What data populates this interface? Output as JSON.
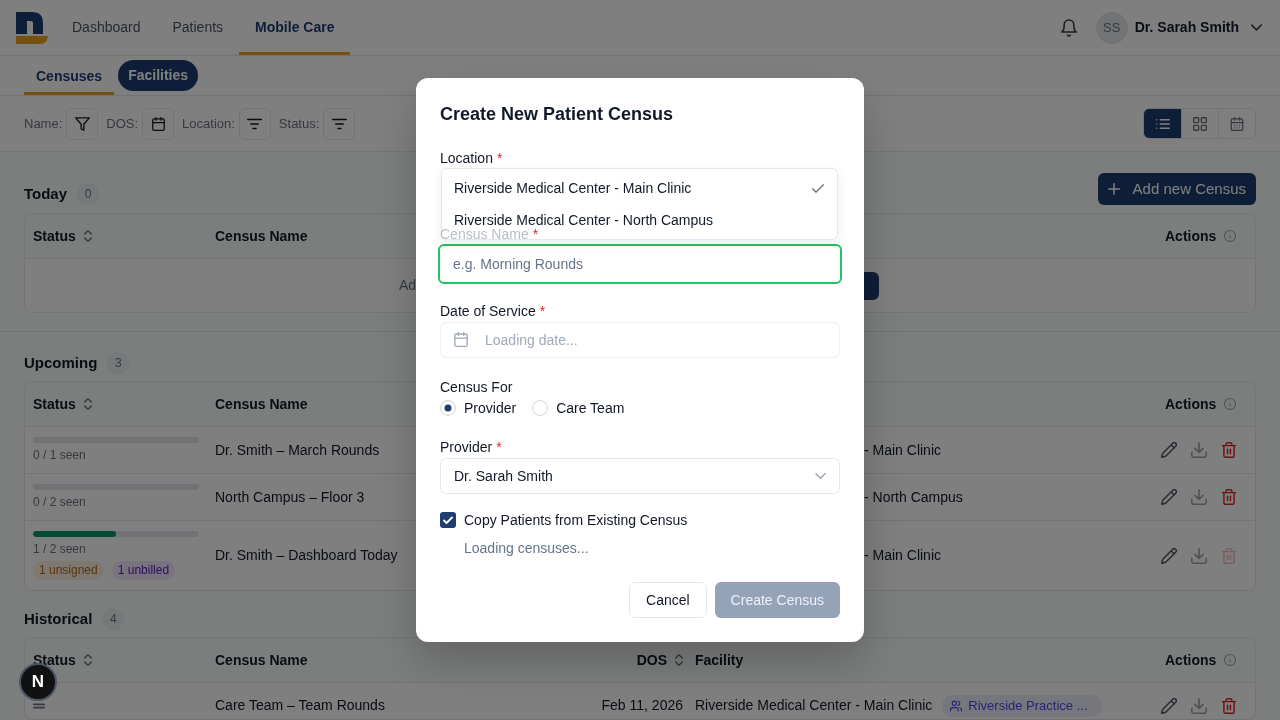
{
  "app_bar": {
    "nav": [
      {
        "label": "Dashboard",
        "selected": false
      },
      {
        "label": "Patients",
        "selected": false
      },
      {
        "label": "Mobile Care",
        "selected": true
      }
    ],
    "avatar": "SS",
    "user_name": "Dr. Sarah Smith"
  },
  "subtabs": [
    {
      "label": "Censuses",
      "selected": true,
      "highlighted": false
    },
    {
      "label": "Facilities",
      "selected": false,
      "highlighted": true
    }
  ],
  "filters": [
    {
      "label": "Name:",
      "kind": "funnel"
    },
    {
      "label": "DOS:",
      "kind": "calendar"
    },
    {
      "label": "Location:",
      "kind": "lines"
    },
    {
      "label": "Status:",
      "kind": "lines"
    }
  ],
  "view_modes": [
    {
      "kind": "list",
      "selected": true
    },
    {
      "kind": "grid",
      "selected": false
    },
    {
      "kind": "calendar",
      "selected": false
    }
  ],
  "sections": [
    {
      "title": "Today",
      "count": "0",
      "add_button": "Add new Census",
      "columns": [
        {
          "label": "Status",
          "kind": "status",
          "sortable": true
        },
        {
          "label": "Census Name",
          "kind": "name",
          "sortable": false
        },
        {
          "label": "Actions",
          "kind": "actions",
          "sortable": false
        }
      ],
      "empty": {
        "text": "Ad",
        "button": true
      }
    },
    {
      "title": "Upcoming",
      "count": "3",
      "columns": [
        {
          "label": "Status",
          "kind": "status",
          "sortable": true
        },
        {
          "label": "Census Name",
          "kind": "name",
          "sortable": false
        },
        {
          "label": "Actions",
          "kind": "actions",
          "sortable": false
        }
      ],
      "rows": [
        {
          "status": {
            "kind": "progress",
            "level": 0,
            "reading": "0 / 1 seen"
          },
          "name": "Dr. Smith – March Rounds",
          "facility": "- Main Clinic",
          "delete_disabled": false
        },
        {
          "status": {
            "kind": "progress",
            "level": 0,
            "reading": "0 / 2 seen"
          },
          "name": "North Campus – Floor 3",
          "facility": "- North Campus",
          "delete_disabled": false
        },
        {
          "status": {
            "kind": "progress",
            "level": 0.5,
            "reading": "1 / 2 seen",
            "badges": [
              {
                "text": "1 unsigned",
                "color": "#7f7870"
              },
              {
                "text": "1 unbilled",
                "color": "#78737f"
              }
            ]
          },
          "name": "Dr. Smith – Dashboard Today",
          "facility": "- Main Clinic",
          "delete_disabled": true
        }
      ]
    },
    {
      "title": "Historical",
      "count": "4",
      "columns": [
        {
          "label": "Status",
          "kind": "status",
          "sortable": true
        },
        {
          "label": "Census Name",
          "kind": "name",
          "sortable": false
        },
        {
          "label": "DOS",
          "kind": "dos",
          "sortable": true
        },
        {
          "label": "Facility",
          "kind": "facility",
          "sortable": false
        },
        {
          "label": "Actions",
          "kind": "actions",
          "sortable": false
        }
      ],
      "rows": [
        {
          "status": {
            "kind": "dash"
          },
          "name": "Care Team – Team Rounds",
          "dos": "Feb 11, 2026",
          "facility": "Riverside Medical Center - Main Clinic",
          "tag": "Riverside Practice ...",
          "delete_disabled": false
        }
      ]
    }
  ],
  "modal": {
    "title": "Create New Patient Census",
    "location": {
      "label": "Location",
      "required_mark": "*",
      "options": [
        {
          "label": "Riverside Medical Center - Main Clinic",
          "selected": true
        },
        {
          "label": "Riverside Medical Center - North Campus",
          "selected": false
        }
      ]
    },
    "census_name": {
      "label": "Census Name",
      "required_mark": "*",
      "placeholder": "e.g. Morning Rounds",
      "focused": true
    },
    "date_of_service": {
      "label": "Date of Service",
      "required_mark": "*",
      "placeholder": "Loading date..."
    },
    "census_for": {
      "label": "Census For",
      "options": [
        {
          "label": "Provider",
          "selected": true
        },
        {
          "label": "Care Team",
          "selected": false
        }
      ]
    },
    "provider": {
      "label": "Provider",
      "required_mark": "*",
      "value": "Dr. Sarah Smith"
    },
    "copy_patients": {
      "label": "Copy Patients from Existing Census",
      "checked": true,
      "status": "Loading censuses..."
    },
    "buttons": [
      {
        "label": "Cancel",
        "kind": "secondary",
        "disabled": false
      },
      {
        "label": "Create Census",
        "kind": "primary",
        "disabled": true
      }
    ]
  },
  "dev_button": "N"
}
